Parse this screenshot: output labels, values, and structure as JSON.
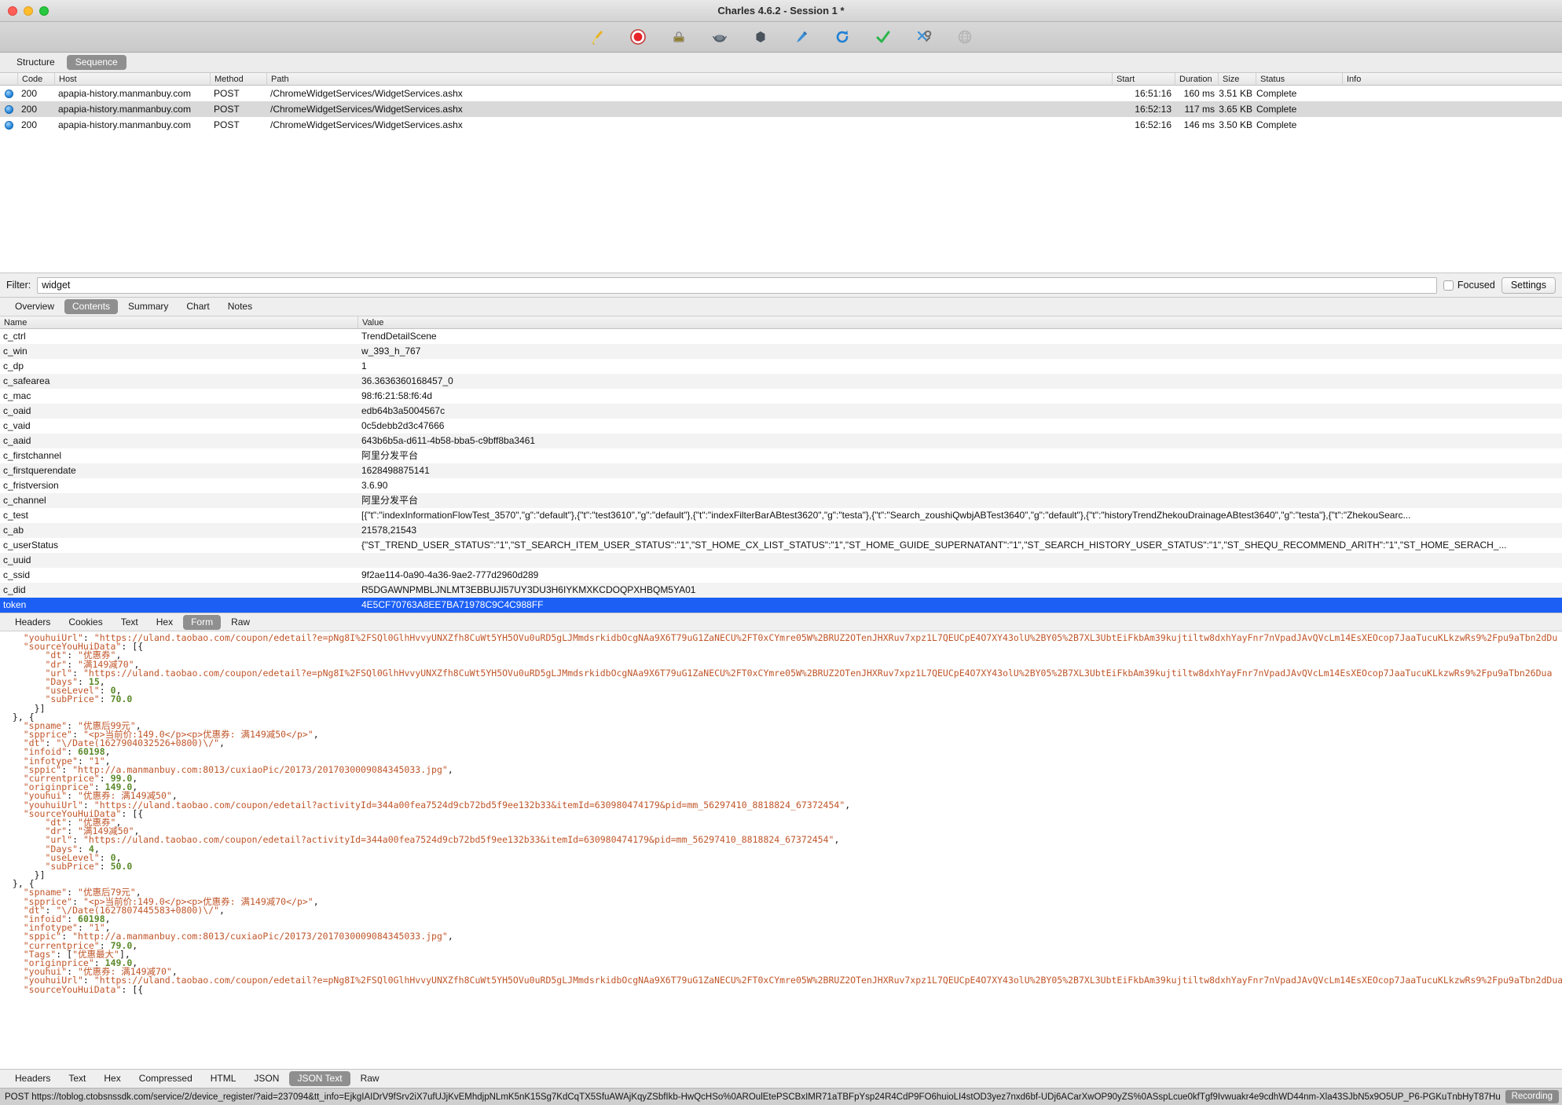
{
  "window": {
    "title": "Charles 4.6.2 - Session 1 *"
  },
  "toolbar": {
    "icons": [
      {
        "name": "clear-broom-icon",
        "label": "Clear"
      },
      {
        "name": "record-icon",
        "label": "Record"
      },
      {
        "name": "throttle-icon",
        "label": "Throttle"
      },
      {
        "name": "breakpoints-icon",
        "label": "Breakpoints"
      },
      {
        "name": "compose-icon",
        "label": "Compose"
      },
      {
        "name": "pen-tool-icon",
        "label": "Edit"
      },
      {
        "name": "repeat-icon",
        "label": "Repeat"
      },
      {
        "name": "validate-check-icon",
        "label": "Validate"
      },
      {
        "name": "tools-icon",
        "label": "Tools"
      },
      {
        "name": "map-remote-icon",
        "label": "Map Remote"
      }
    ]
  },
  "view_tabs": {
    "items": [
      "Structure",
      "Sequence"
    ],
    "active": "Sequence"
  },
  "session_table": {
    "columns": [
      "Code",
      "Host",
      "Method",
      "Path",
      "Start",
      "Duration",
      "Size",
      "Status",
      "Info"
    ],
    "rows": [
      {
        "icon": "globe-icon",
        "code": "200",
        "host": "apapia-history.manmanbuy.com",
        "method": "POST",
        "path": "/ChromeWidgetServices/WidgetServices.ashx",
        "start": "16:51:16",
        "duration": "160 ms",
        "size": "3.51 KB",
        "status": "Complete",
        "info": ""
      },
      {
        "icon": "globe-icon",
        "code": "200",
        "host": "apapia-history.manmanbuy.com",
        "method": "POST",
        "path": "/ChromeWidgetServices/WidgetServices.ashx",
        "start": "16:52:13",
        "duration": "117 ms",
        "size": "3.65 KB",
        "status": "Complete",
        "info": ""
      },
      {
        "icon": "globe-icon",
        "code": "200",
        "host": "apapia-history.manmanbuy.com",
        "method": "POST",
        "path": "/ChromeWidgetServices/WidgetServices.ashx",
        "start": "16:52:16",
        "duration": "146 ms",
        "size": "3.50 KB",
        "status": "Complete",
        "info": ""
      }
    ]
  },
  "filter": {
    "label": "Filter:",
    "value": "widget",
    "placeholder": "",
    "focused_label": "Focused",
    "focused_checked": false,
    "settings_label": "Settings"
  },
  "inspector_tabs": {
    "items": [
      "Overview",
      "Contents",
      "Summary",
      "Chart",
      "Notes"
    ],
    "active": "Contents"
  },
  "contents_table": {
    "columns": [
      "Name",
      "Value"
    ],
    "rows": [
      {
        "name": "c_ctrl",
        "value": "TrendDetailScene",
        "selected": false
      },
      {
        "name": "c_win",
        "value": "w_393_h_767",
        "selected": false
      },
      {
        "name": "c_dp",
        "value": "1",
        "selected": false
      },
      {
        "name": "c_safearea",
        "value": "36.3636360168457_0",
        "selected": false
      },
      {
        "name": "c_mac",
        "value": "98:f6:21:58:f6:4d",
        "selected": false
      },
      {
        "name": "c_oaid",
        "value": "edb64b3a5004567c",
        "selected": false
      },
      {
        "name": "c_vaid",
        "value": "0c5debb2d3c47666",
        "selected": false
      },
      {
        "name": "c_aaid",
        "value": "643b6b5a-d611-4b58-bba5-c9bff8ba3461",
        "selected": false
      },
      {
        "name": "c_firstchannel",
        "value": "阿里分发平台",
        "selected": false
      },
      {
        "name": "c_firstquerendate",
        "value": "1628498875141",
        "selected": false
      },
      {
        "name": "c_fristversion",
        "value": "3.6.90",
        "selected": false
      },
      {
        "name": "c_channel",
        "value": "阿里分发平台",
        "selected": false
      },
      {
        "name": "c_test",
        "value": "[{\"t\":\"indexInformationFlowTest_3570\",\"g\":\"default\"},{\"t\":\"test3610\",\"g\":\"default\"},{\"t\":\"indexFilterBarABtest3620\",\"g\":\"testa\"},{\"t\":\"Search_zoushiQwbjABTest3640\",\"g\":\"default\"},{\"t\":\"historyTrendZhekouDrainageABtest3640\",\"g\":\"testa\"},{\"t\":\"ZhekouSearc...",
        "selected": false
      },
      {
        "name": "c_ab",
        "value": "21578,21543",
        "selected": false
      },
      {
        "name": "c_userStatus",
        "value": "{\"ST_TREND_USER_STATUS\":\"1\",\"ST_SEARCH_ITEM_USER_STATUS\":\"1\",\"ST_HOME_CX_LIST_STATUS\":\"1\",\"ST_HOME_GUIDE_SUPERNATANT\":\"1\",\"ST_SEARCH_HISTORY_USER_STATUS\":\"1\",\"ST_SHEQU_RECOMMEND_ARITH\":\"1\",\"ST_HOME_SERACH_...",
        "selected": false
      },
      {
        "name": "c_uuid",
        "value": "",
        "selected": false
      },
      {
        "name": "c_ssid",
        "value": "9f2ae114-0a90-4a36-9ae2-777d2960d289",
        "selected": false
      },
      {
        "name": "c_did",
        "value": "R5DGAWNPMBLJNLMT3EBBUJI57UY3DU3H6IYKMXKCDOQPXHBQM5YA01",
        "selected": false
      },
      {
        "name": "token",
        "value": "4E5CF70763A8EE7BA71978C9C4C988FF",
        "selected": true
      }
    ]
  },
  "request_tabs": {
    "items": [
      "Headers",
      "Cookies",
      "Text",
      "Hex",
      "Form",
      "Raw"
    ],
    "active": "Form"
  },
  "json_body": {
    "lines": [
      "    \"youhuiUrl\": \"https://uland.taobao.com/coupon/edetail?e=pNg8I%2FSQl0GlhHvvyUNXZfh8CuWt5YH5OVu0uRD5gLJMmdsrkidbOcgNAa9X6T79uG1ZaNECU%2FT0xCYmre05W%2BRUZ2OTenJHXRuv7xpz1L7QEUCpE4O7XY43olU%2BY05%2B7XL3UbtEiFkbAm39kujtiltw8dxhYayFnr7nVpadJAvQVcLm14EsXEOcop7JaaTucuKLkzwRs9%2Fpu9aTbn2dDu",
      "    \"sourceYouHuiData\": [{",
      "        \"dt\": \"优惠券\",",
      "        \"dr\": \"满149减70\",",
      "        \"url\": \"https://uland.taobao.com/coupon/edetail?e=pNg8I%2FSQl0GlhHvvyUNXZfh8CuWt5YH5OVu0uRD5gLJMmdsrkidbOcgNAa9X6T79uG1ZaNECU%2FT0xCYmre05W%2BRUZ2OTenJHXRuv7xpz1L7QEUCpE4O7XY43olU%2BY05%2B7XL3UbtEiFkbAm39kujtiltw8dxhYayFnr7nVpadJAvQVcLm14EsXEOcop7JaaTucuKLkzwRs9%2Fpu9aTbn26Dua",
      "        \"Days\": 15,",
      "        \"useLevel\": 0,",
      "        \"subPrice\": 70.0",
      "      }]",
      "  }, {",
      "    \"spname\": \"优惠后99元\",",
      "    \"spprice\": \"<p>当前价:149.0</p><p>优惠券: 满149减50</p>\",",
      "    \"dt\": \"\\/Date(1627904032526+0800)\\/\",",
      "    \"infoid\": 60198,",
      "    \"infotype\": \"1\",",
      "    \"sppic\": \"http://a.manmanbuy.com:8013/cuxiaoPic/20173/2017030009084345033.jpg\",",
      "    \"currentprice\": 99.0,",
      "    \"originprice\": 149.0,",
      "    \"youhui\": \"优惠券: 满149减50\",",
      "    \"youhuiUrl\": \"https://uland.taobao.com/coupon/edetail?activityId=344a00fea7524d9cb72bd5f9ee132b33&itemId=630980474179&pid=mm_56297410_8818824_67372454\",",
      "    \"sourceYouHuiData\": [{",
      "        \"dt\": \"优惠券\",",
      "        \"dr\": \"满149减50\",",
      "        \"url\": \"https://uland.taobao.com/coupon/edetail?activityId=344a00fea7524d9cb72bd5f9ee132b33&itemId=630980474179&pid=mm_56297410_8818824_67372454\",",
      "        \"Days\": 4,",
      "        \"useLevel\": 0,",
      "        \"subPrice\": 50.0",
      "      }]",
      "  }, {",
      "    \"spname\": \"优惠后79元\",",
      "    \"spprice\": \"<p>当前价:149.0</p><p>优惠券: 满149减70</p>\",",
      "    \"dt\": \"\\/Date(1627807445583+0800)\\/\",",
      "    \"infoid\": 60198,",
      "    \"infotype\": \"1\",",
      "    \"sppic\": \"http://a.manmanbuy.com:8013/cuxiaoPic/20173/2017030009084345033.jpg\",",
      "    \"currentprice\": 79.0,",
      "    \"Tags\": [\"优惠最大\"],",
      "    \"originprice\": 149.0,",
      "    \"youhui\": \"优惠券: 满149减70\",",
      "    \"youhuiUrl\": \"https://uland.taobao.com/coupon/edetail?e=pNg8I%2FSQl0GlhHvvyUNXZfh8CuWt5YH5OVu0uRD5gLJMmdsrkidbOcgNAa9X6T79uG1ZaNECU%2FT0xCYmre05W%2BRUZ2OTenJHXRuv7xpz1L7QEUCpE4O7XY43olU%2BY05%2B7XL3UbtEiFkbAm39kujtiltw8dxhYayFnr7nVpadJAvQVcLm14EsXEOcop7JaaTucuKLkzwRs9%2Fpu9aTbn2dDua",
      "    \"sourceYouHuiData\": [{"
    ]
  },
  "response_tabs": {
    "items": [
      "Headers",
      "Text",
      "Hex",
      "Compressed",
      "HTML",
      "JSON",
      "JSON Text",
      "Raw"
    ],
    "active": "JSON Text"
  },
  "statusbar": {
    "url": "POST https://toblog.ctobsnssdk.com/service/2/device_register/?aid=237094&tt_info=EjkgIAIDrV9fSrv2iX7ufUJjKvEMhdjpNLmK5nK15Sg7KdCqTX5SfuAWAjKqyZSbfIkb-HwQcHSo%0AROulEtePSCBxIMR71aTBFpYsp24R4CdP9FO6huioLI4stOD3yez7nxd6bf-UDj6ACarXwOP90yZS%0ASspLcue0kfTgf9Ivwuakr4e9cdhWD44nm-Xla43SJbN5x9O5UP_P6-PGKuTnbHyT87Hu...",
    "recording_label": "Recording"
  }
}
